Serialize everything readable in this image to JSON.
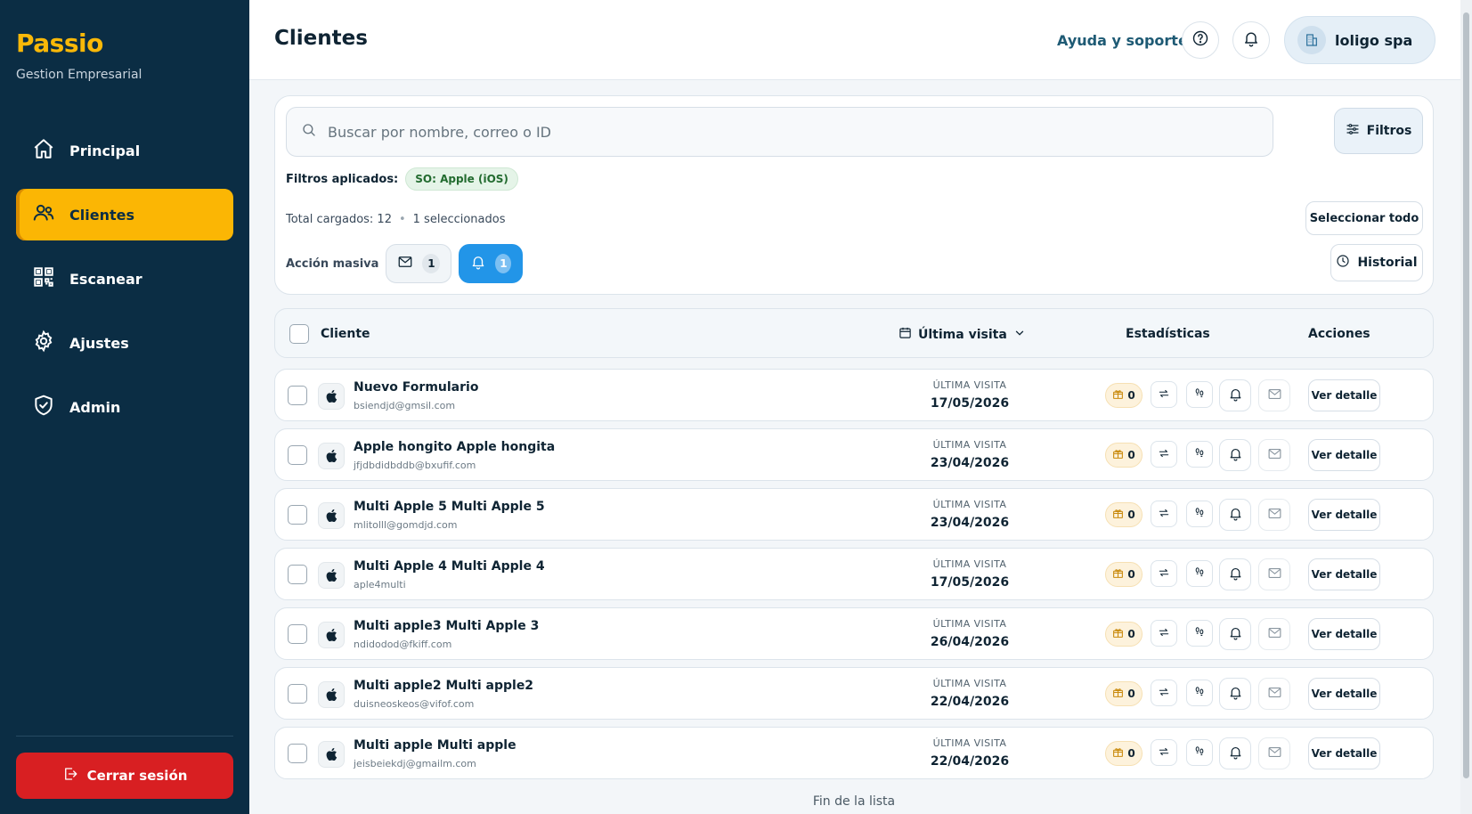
{
  "sidebar": {
    "brand": "Passio",
    "subtitle": "Gestion Empresarial",
    "items": [
      {
        "label": "Principal",
        "icon": "home-icon"
      },
      {
        "label": "Clientes",
        "icon": "users-icon",
        "active": true
      },
      {
        "label": "Escanear",
        "icon": "qr-icon"
      },
      {
        "label": "Ajustes",
        "icon": "gear-icon"
      },
      {
        "label": "Admin",
        "icon": "shield-icon"
      }
    ],
    "logout_label": "Cerrar sesión"
  },
  "header": {
    "title": "Clientes",
    "help_label": "Ayuda y soporte",
    "company": "loligo spa"
  },
  "filters": {
    "search_placeholder": "Buscar por nombre, correo o ID",
    "filters_button": "Filtros",
    "applied_label": "Filtros aplicados:",
    "applied_chip": "SO: Apple (iOS)",
    "total_loaded": "Total cargados: 12",
    "selected": "1 seleccionados",
    "select_all": "Seleccionar todo",
    "mass_action_label": "Acción masiva",
    "mail_count": "1",
    "bell_count": "1",
    "history_label": "Historial"
  },
  "table": {
    "headers": {
      "client": "Cliente",
      "last_visit": "Última visita",
      "stats": "Estadísticas",
      "actions": "Acciones"
    },
    "visit_label": "ÚLTIMA VISITA",
    "detail_label": "Ver detalle",
    "rows": [
      {
        "name": "Nuevo Formulario",
        "email": "bsiendjd@gmsil.com",
        "date": "17/05/2026",
        "points": "0"
      },
      {
        "name": "Apple hongito Apple hongita",
        "email": "jfjdbdidbddb@bxufif.com",
        "date": "23/04/2026",
        "points": "0"
      },
      {
        "name": "Multi Apple 5 Multi Apple 5",
        "email": "mlitolll@gomdjd.com",
        "date": "23/04/2026",
        "points": "0"
      },
      {
        "name": "Multi Apple 4 Multi Apple 4",
        "email": "aple4multi",
        "date": "17/05/2026",
        "points": "0"
      },
      {
        "name": "Multi apple3 Multi Apple 3",
        "email": "ndidodod@fkiff.com",
        "date": "26/04/2026",
        "points": "0"
      },
      {
        "name": "Multi apple2 Multi apple2",
        "email": "duisneoskeos@vifof.com",
        "date": "22/04/2026",
        "points": "0"
      },
      {
        "name": "Multi apple Multi apple",
        "email": "jeisbeiekdj@gmailm.com",
        "date": "22/04/2026",
        "points": "0"
      }
    ],
    "end_label": "Fin de la lista"
  },
  "colors": {
    "sidebar_bg": "#0b2d44",
    "accent": "#fbb604",
    "logout": "#d81f22",
    "primary_blue": "#2295e8"
  }
}
